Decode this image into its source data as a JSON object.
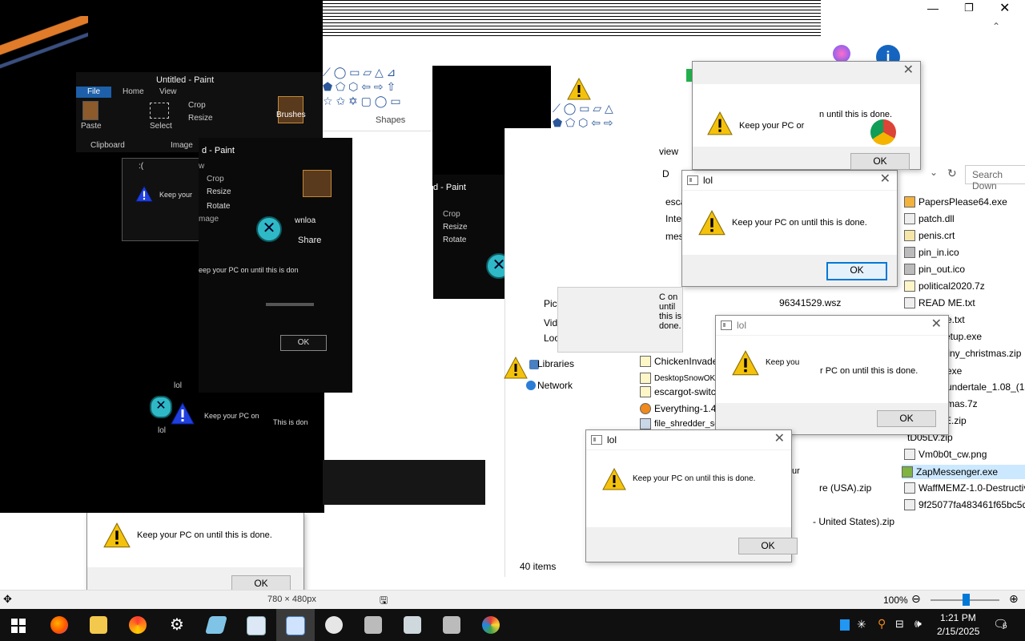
{
  "taskbar": {
    "time": "1:21 PM",
    "date": "2/15/2025",
    "notification_count": "6"
  },
  "paint": {
    "title": "Untitled - Paint",
    "title_fragment": "d - Paint",
    "tabs": [
      "File",
      "Home",
      "View"
    ],
    "tab_fragment": "w",
    "paste": "Paste",
    "clipboard": "Clipboard",
    "select": "Select",
    "image_group": "Image",
    "image_fragment": "mage",
    "crop": "Crop",
    "resize": "Resize",
    "rotate": "Rotate",
    "brushes": "Brushes",
    "shapes": "Shapes",
    "canvas_size": "780 × 480px",
    "zoom": "100%",
    "downloads_fragment": "wnloa",
    "share": "Share"
  },
  "explorer": {
    "search_placeholder": "Search Down",
    "item_count": "40 items",
    "view_fragment": "view",
    "drive_fragment": "D",
    "nav_items": [
      "Libraries",
      "Network"
    ],
    "nav_fragments": [
      "Pict",
      "Vid",
      "Loc"
    ],
    "files_right": [
      "PapersPlease64.exe",
      "patch.dll",
      "penis.crt",
      "pin_in.ico",
      "pin_out.ico",
      "political2020.7z",
      "READ ME.txt",
      "Vm0b0t_cw.png",
      "ZapMessenger.exe",
      "WaffMEMZ-1.0-Destructiv",
      "9f25077fa483461f65bc5d3"
    ],
    "files_right_fragments": [
      "e.txt",
      "etup.exe",
      "tiny_christmas.zip",
      "exe",
      "undertale_1.08_(183",
      "mas.7z",
      "E.zip",
      "tD05LV.zip"
    ],
    "files_mid": [
      "ChickenInvaders",
      "DesktopSnowOK",
      "escargot-switch",
      "Everything-1.4.1",
      "file_shredder_setup.exe"
    ],
    "files_mid_fragments": [
      "esca",
      "Inte",
      "mes",
      "96341529.wsz",
      "re (USA).zip",
      "- United States).zip",
      "ur"
    ]
  },
  "dialogs": {
    "title": "lol",
    "title_fragment": ":(",
    "message": "Keep your PC on until this is done.",
    "ok": "OK",
    "fragments": {
      "top": "Keep your PC or",
      "top_end": "n until this is done.",
      "mid_left": "Keep you",
      "mid_right": "r PC on until this is done.",
      "small": "Keep your",
      "dark": "eep your PC on until this is don",
      "tiny": "Keep your PC on",
      "tiny2": "This is don",
      "partial": "C on until this is done.",
      "mid2": "Keep your PC on until this is done."
    }
  },
  "colors": {
    "accent": "#0078d7",
    "warning": "#f4c20d",
    "taskbar": "#101010"
  }
}
